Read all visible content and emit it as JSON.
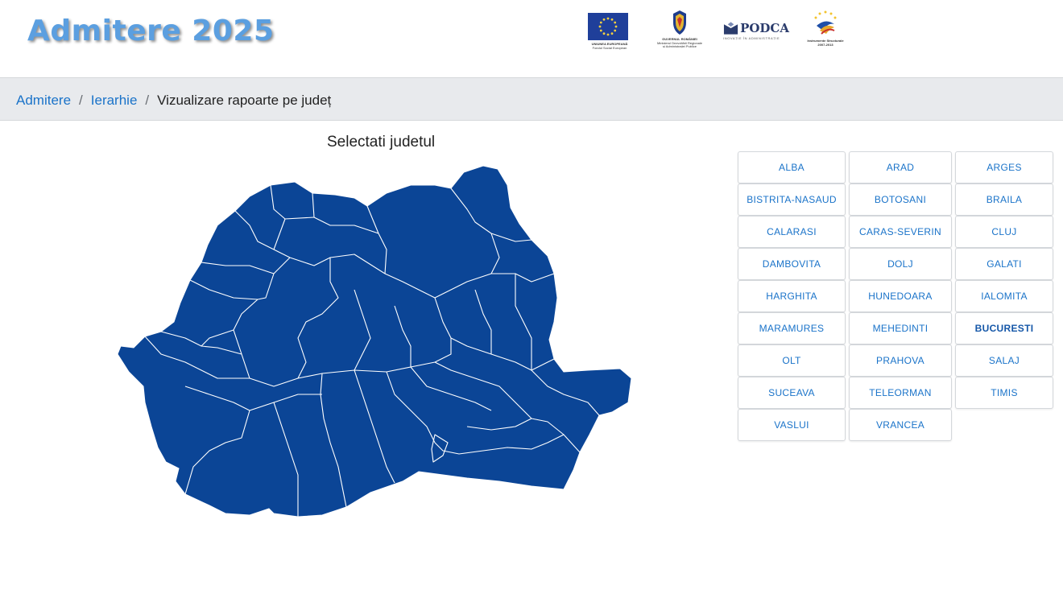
{
  "header": {
    "title": "Admitere 2025",
    "logos": {
      "eu_caption_1": "UNIUNEA EUROPEANĂ",
      "eu_caption_2": "Fondul Social European",
      "gov_caption_1": "GUVERNUL ROMÂNIEI",
      "gov_caption_2": "Ministerul Dezvoltării Regionale",
      "gov_caption_3": "și Administrației Publice",
      "podca_name": "PODCA",
      "podca_tagline": "INOVAȚIE ÎN ADMINISTRAȚIE",
      "is_caption_1": "Instrumente Structurale",
      "is_caption_2": "2007-2013"
    }
  },
  "breadcrumb": {
    "items": [
      {
        "label": "Admitere"
      },
      {
        "label": "Ierarhie"
      }
    ],
    "separator": "/",
    "current": "Vizualizare rapoarte pe județ"
  },
  "map": {
    "title": "Selectati judetul",
    "fill_color": "#0b4596",
    "border_color": "#ffffff"
  },
  "counties": {
    "active": "BUCURESTI",
    "col1": [
      "ALBA",
      "BISTRITA-NASAUD",
      "CALARASI",
      "DAMBOVITA",
      "HARGHITA",
      "MARAMURES",
      "OLT",
      "SUCEAVA",
      "VASLUI"
    ],
    "col2": [
      "ARAD",
      "BOTOSANI",
      "CARAS-SEVERIN",
      "DOLJ",
      "HUNEDOARA",
      "MEHEDINTI",
      "PRAHOVA",
      "TELEORMAN",
      "VRANCEA"
    ],
    "col3": [
      "ARGES",
      "BRAILA",
      "CLUJ",
      "GALATI",
      "IALOMITA",
      "BUCURESTI",
      "SALAJ",
      "TIMIS"
    ]
  }
}
